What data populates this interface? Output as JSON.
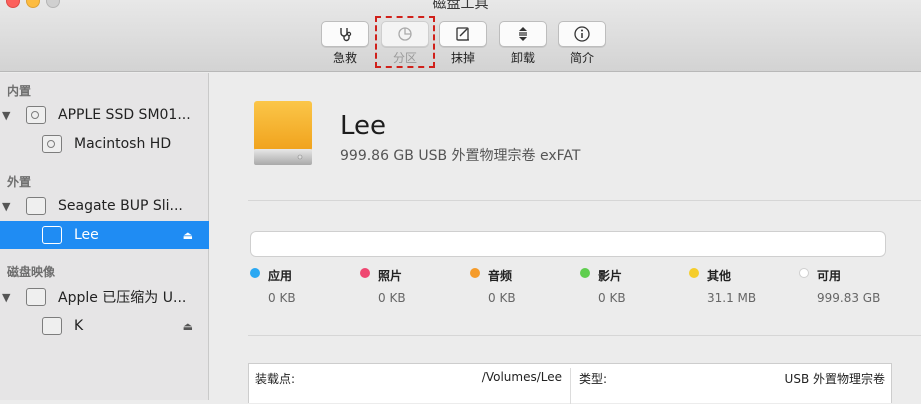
{
  "window": {
    "title": "磁盘工具"
  },
  "toolbar": {
    "buttons": [
      {
        "label": "急救",
        "icon": "stethoscope-icon",
        "enabled": true
      },
      {
        "label": "分区",
        "icon": "pie-partition-icon",
        "enabled": false
      },
      {
        "label": "抹掉",
        "icon": "erase-icon",
        "enabled": true
      },
      {
        "label": "卸载",
        "icon": "unmount-icon",
        "enabled": true
      },
      {
        "label": "简介",
        "icon": "info-icon",
        "enabled": true
      }
    ]
  },
  "sidebar": {
    "sections": [
      {
        "header": "内置"
      },
      {
        "header": "外置"
      },
      {
        "header": "磁盘映像"
      }
    ],
    "items": [
      {
        "label": "APPLE SSD SM01...",
        "level": 0
      },
      {
        "label": "Macintosh HD",
        "level": 1
      },
      {
        "label": "Seagate BUP Sli...",
        "level": 0
      },
      {
        "label": "Lee",
        "level": 1,
        "selected": true,
        "eject": "⏏"
      },
      {
        "label": "Apple 已压缩为 U...",
        "level": 0
      },
      {
        "label": "K",
        "level": 1,
        "eject": "⏏"
      }
    ]
  },
  "volume": {
    "name": "Lee",
    "description": "999.86 GB USB 外置物理宗卷 exFAT"
  },
  "usage": {
    "categories": [
      {
        "name": "应用",
        "value": "0 KB",
        "color": "#2aa8f2"
      },
      {
        "name": "照片",
        "value": "0 KB",
        "color": "#ef4771"
      },
      {
        "name": "音频",
        "value": "0 KB",
        "color": "#f59b2a"
      },
      {
        "name": "影片",
        "value": "0 KB",
        "color": "#5fce4e"
      },
      {
        "name": "其他",
        "value": "31.1 MB",
        "color": "#f5cd2b"
      },
      {
        "name": "可用",
        "value": "999.83 GB",
        "color": "#ffffff"
      }
    ]
  },
  "info": {
    "mount_label": "装载点:",
    "mount_value": "/Volumes/Lee",
    "type_label": "类型:",
    "type_value": "USB 外置物理宗卷"
  },
  "colors": {
    "accent": "#1f8cf3",
    "highlight_border": "#d0201a"
  }
}
